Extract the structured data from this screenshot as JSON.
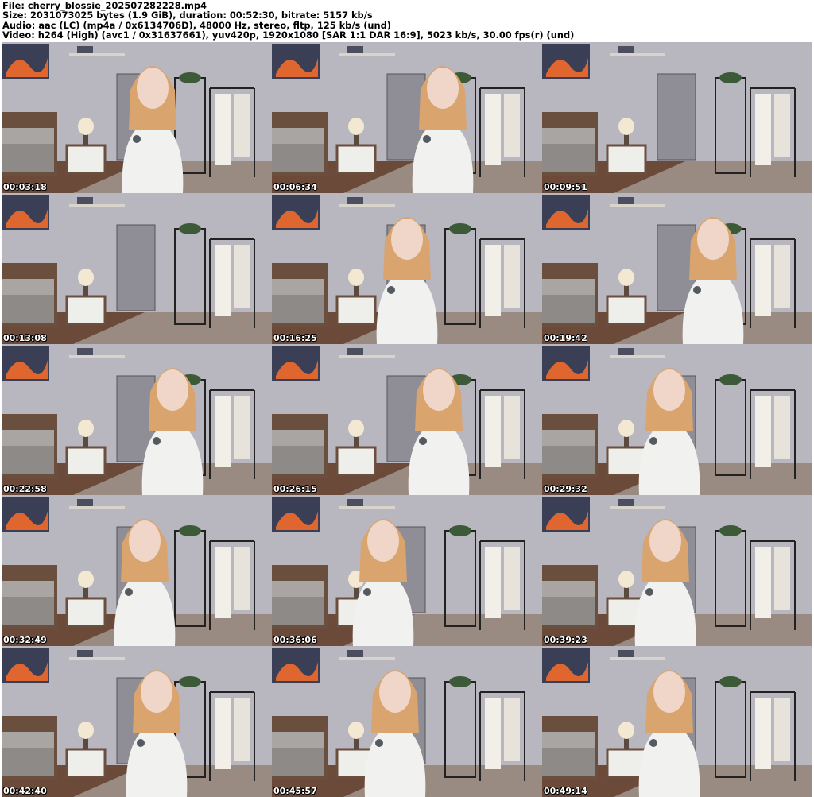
{
  "header": {
    "file_line": "File: cherry_blossie_202507282228.mp4",
    "size_line": "Size: 2031073025 bytes (1.9 GiB), duration: 00:52:30, bitrate: 5157 kb/s",
    "audio_line": "Audio: aac (LC) (mp4a / 0x6134706D), 48000 Hz, stereo, fltp, 125 kb/s (und)",
    "video_line": "Video: h264 (High) (avc1 / 0x31637661), yuv420p, 1920x1080 [SAR 1:1 DAR 16:9], 5023 kb/s, 30.00 fps(r) (und)"
  },
  "thumbnails": [
    {
      "timestamp": "00:03:18"
    },
    {
      "timestamp": "00:06:34"
    },
    {
      "timestamp": "00:09:51"
    },
    {
      "timestamp": "00:13:08"
    },
    {
      "timestamp": "00:16:25"
    },
    {
      "timestamp": "00:19:42"
    },
    {
      "timestamp": "00:22:58"
    },
    {
      "timestamp": "00:26:15"
    },
    {
      "timestamp": "00:29:32"
    },
    {
      "timestamp": "00:32:49"
    },
    {
      "timestamp": "00:36:06"
    },
    {
      "timestamp": "00:39:23"
    },
    {
      "timestamp": "00:42:40"
    },
    {
      "timestamp": "00:45:57"
    },
    {
      "timestamp": "00:49:14"
    }
  ]
}
